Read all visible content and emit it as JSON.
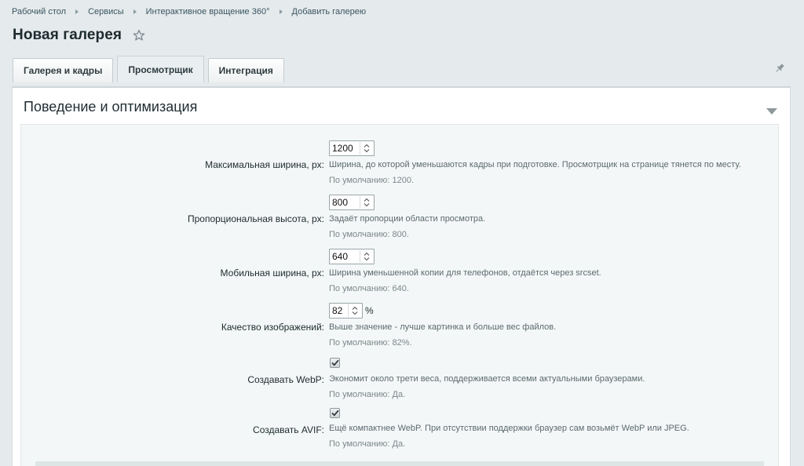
{
  "breadcrumb": {
    "items": [
      "Рабочий стол",
      "Сервисы",
      "Интерактивное вращение 360°",
      "Добавить галерею"
    ]
  },
  "page": {
    "title": "Новая галерея",
    "favorite_icon": "star-outline-icon"
  },
  "tabs": [
    {
      "label": "Галерея и кадры",
      "active": false
    },
    {
      "label": "Просмотрщик",
      "active": true
    },
    {
      "label": "Интеграция",
      "active": false
    }
  ],
  "toolbar": {
    "pin_icon": "pin-icon"
  },
  "section": {
    "title": "Поведение и оптимизация",
    "collapse_icon": "triangle-down-icon"
  },
  "fields": [
    {
      "label": "Максимальная ширина, px:",
      "value": "1200",
      "hint": "Ширина, до которой уменьшаются кадры при подготовке. Просмотрщик на странице тянется по месту.",
      "default": "По умолчанию: 1200."
    },
    {
      "label": "Пропорциональная высота, px:",
      "value": "800",
      "hint": "Задаёт пропорции области просмотра.",
      "default": "По умолчанию: 800."
    },
    {
      "label": "Мобильная ширина, px:",
      "value": "640",
      "hint": "Ширина уменьшенной копии для телефонов, отдаётся через srcset.",
      "default": "По умолчанию: 640."
    },
    {
      "label": "Качество изображений:",
      "value": "82",
      "unit": "%",
      "hint": "Выше значение - лучше картинка и больше вес файлов.",
      "default": "По умолчанию: 82%."
    },
    {
      "label": "Создавать WebP:",
      "checked": true,
      "hint": "Экономит около трети веса, поддерживается всеми актуальными браузерами.",
      "default": "По умолчанию: Да."
    },
    {
      "label": "Создавать AVIF:",
      "checked": true,
      "hint": "Ещё компактнее WebP. При отсутствии поддержки браузер сам возьмёт WebP или JPEG.",
      "default": "По умолчанию: Да."
    }
  ],
  "colors": {
    "page_bg": "#e5eaec",
    "panel_bg": "#ffffff",
    "section_bg": "#f4f7f7",
    "link": "#3a5560"
  }
}
